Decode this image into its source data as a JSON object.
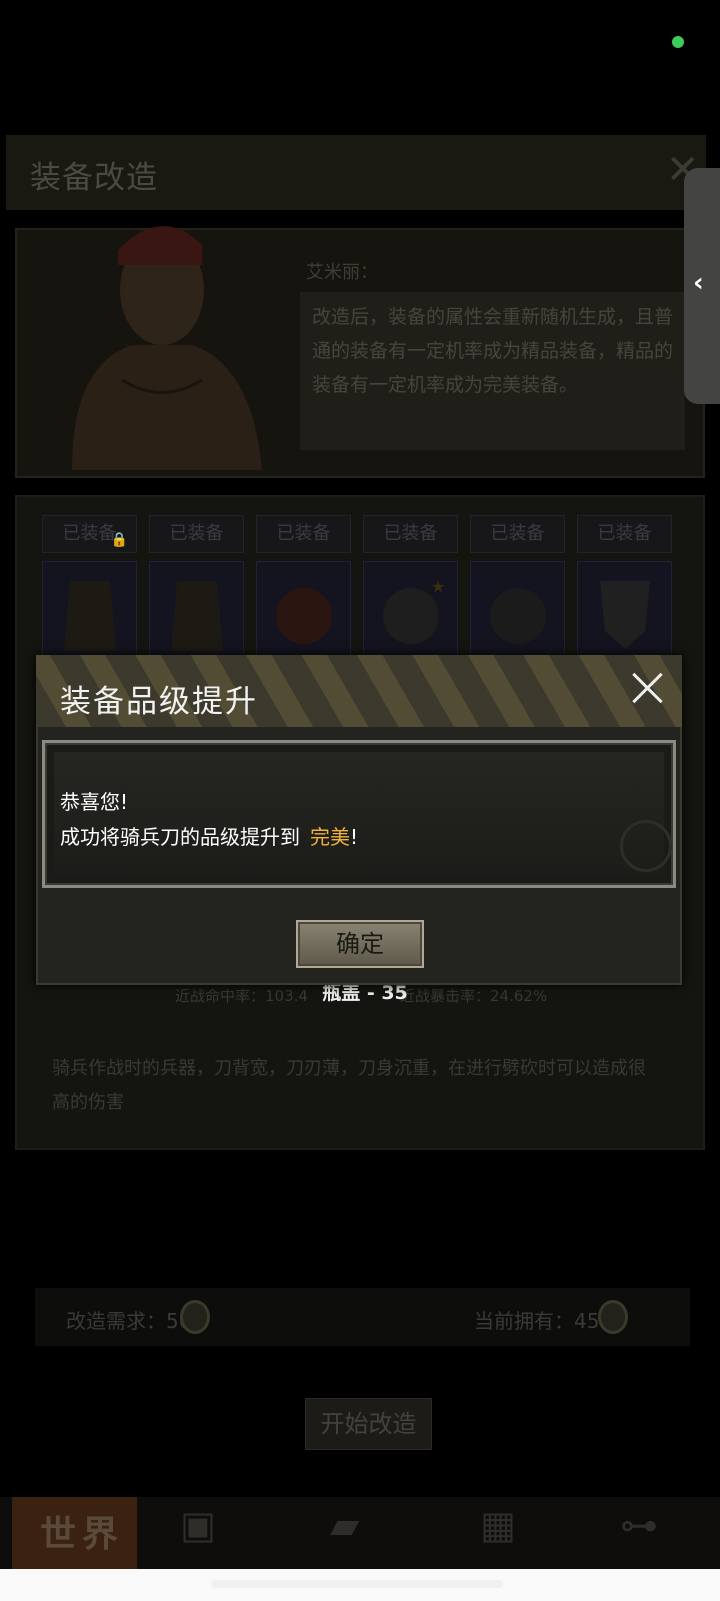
{
  "panel": {
    "title": "装备改造",
    "npc_name": "艾米丽：",
    "npc_speech": "改造后，装备的属性会重新随机生成，且普通的装备有一定机率成为精品装备，精品的装备有一定机率成为完美装备。"
  },
  "equipment": {
    "tags": [
      "已装备",
      "已装备",
      "已装备",
      "已装备",
      "已装备",
      "已装备"
    ],
    "icons": [
      "jacket-icon",
      "jacket-icon",
      "helmet-icon",
      "helmet-icon",
      "helmet-icon",
      "shield-icon"
    ]
  },
  "item": {
    "stat_left": "近战命中率：103.4",
    "stat_right": "近战暴击率：24.62%",
    "bottle_cap": "瓶盖 - 35",
    "description": "骑兵作战时的兵器，刀背宽，刀刃薄，刀身沉重，在进行劈砍时可以造成很高的伤害"
  },
  "cost": {
    "required_label": "改造需求：50",
    "owned_label": "当前拥有：456"
  },
  "start_button": "开始改造",
  "tabbar": {
    "world_label": "世界"
  },
  "modal": {
    "title": "装备品级提升",
    "line1": "恭喜您!",
    "line2_prefix": "成功将骑兵刀的品级提升到",
    "line2_highlight": "完美",
    "line2_suffix": "!",
    "confirm": "确定"
  },
  "colors": {
    "highlight": "#f0b23a",
    "status_dot": "#3fca5a"
  }
}
